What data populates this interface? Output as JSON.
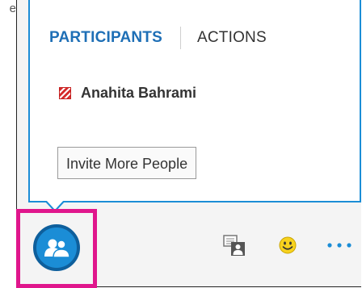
{
  "background_text": "e",
  "tabs": [
    {
      "label": "PARTICIPANTS",
      "active": true
    },
    {
      "label": "ACTIONS",
      "active": false
    }
  ],
  "participants": [
    {
      "name": "Anahita Bahrami",
      "status": "busy"
    }
  ],
  "invite_button": {
    "label": "Invite More People"
  },
  "toolbar": {
    "participants_button_icon": "participants-icon",
    "present_icon": "present-content-icon",
    "emoji_icon": "emoticon-icon",
    "more_icon": "more-options-icon"
  },
  "colors": {
    "accent": "#1b8dd6",
    "highlight": "#e0168c",
    "busy": "#d62a2a",
    "active_tab": "#1e6fb6"
  }
}
